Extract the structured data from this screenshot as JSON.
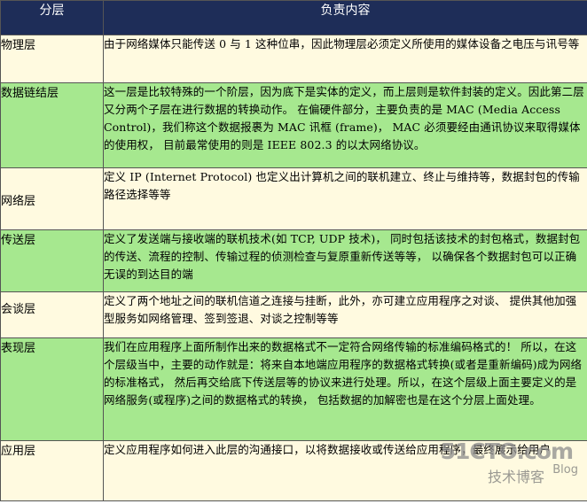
{
  "table": {
    "header": {
      "layer": "分层",
      "responsibility": "负责内容"
    },
    "rows": [
      {
        "layer": "物理层",
        "desc": "由于网络媒体只能传送 0 与 1 这种位串，因此物理层必须定义所使用的媒体设备之电压与讯号等"
      },
      {
        "layer": "数据链结层",
        "desc": "这一层是比较特殊的一个阶层，因为底下是实体的定义，而上层则是软件封装的定义。因此第二层又分两个子层在进行数据的转换动作。 在偏硬件部分，主要负责的是 MAC (Media Access Control)，我们称这个数据报裹为 MAC 讯框 (frame)， MAC 必须要经由通讯协议来取得媒体的使用权， 目前最常使用的则是 IEEE 802.3 的以太网络协议。"
      },
      {
        "layer": "网络层",
        "desc": "定义 IP (Internet Protocol) 也定义出计算机之间的联机建立、终止与维持等，数据封包的传输路径选择等等"
      },
      {
        "layer": "传送层",
        "desc": "定义了发送端与接收端的联机技术(如 TCP, UDP 技术)， 同时包括该技术的封包格式，数据封包的传送、流程的控制、传输过程的侦测检查与复原重新传送等等， 以确保各个数据封包可以正确无误的到达目的端"
      },
      {
        "layer": "会谈层",
        "desc": "定义了两个地址之间的联机信道之连接与挂断，此外，亦可建立应用程序之对谈、 提供其他加强型服务如网络管理、签到签退、对谈之控制等等"
      },
      {
        "layer": "表现层",
        "desc": "我们在应用程序上面所制作出来的数据格式不一定符合网络传输的标准编码格式的！ 所以，在这个层级当中，主要的动作就是：将来自本地端应用程序的数据格式转换(或者是重新编码)成为网络的标准格式， 然后再交给底下传送层等的协议来进行处理。所以，在这个层级上面主要定义的是网络服务(或程序)之间的数据格式的转换， 包括数据的加解密也是在这个分层上面处理。"
      },
      {
        "layer": "应用层",
        "desc": "定义应用程序如何进入此层的沟通接口，以将数据接收或传送给应用程序，最终展示给用户"
      }
    ]
  },
  "watermark": {
    "logo": "51CTO.com",
    "sub": "技术博客",
    "blog": "Blog"
  },
  "colors": {
    "header_bg": "#1e2d58",
    "green_row": "#a6e88f",
    "yellow_row": "#fffae0",
    "border": "#555555"
  }
}
